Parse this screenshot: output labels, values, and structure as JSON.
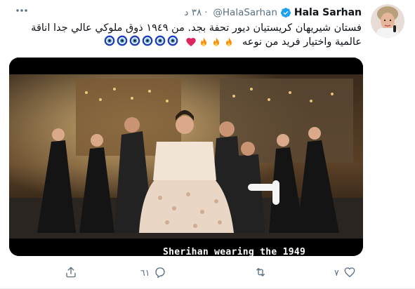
{
  "tweet": {
    "display_name": "Hala Sarhan",
    "handle": "@HalaSarhan",
    "time": "٣٨ د",
    "text_line1": "فستان شيريهان كريستيان ديور تحفة بجد. من ١٩٤٩ ذوق ملوكي عالي جدا اناقة",
    "text_line2": "عالمية واختيار فريد من نوعه",
    "video_caption": "Sherihan wearing the 1949",
    "reply_count": "٦١",
    "like_count": "٧"
  },
  "colors": {
    "verified": "#1da1f2",
    "secondary_text": "#5b7083",
    "heart": "#e0245e",
    "evil_eye": "#1f3fbf"
  },
  "icons": [
    "verified-icon",
    "more-icon",
    "heart-icon",
    "fire-icon",
    "evil-eye-icon",
    "share-icon",
    "reply-icon",
    "retweet-icon",
    "like-icon"
  ]
}
